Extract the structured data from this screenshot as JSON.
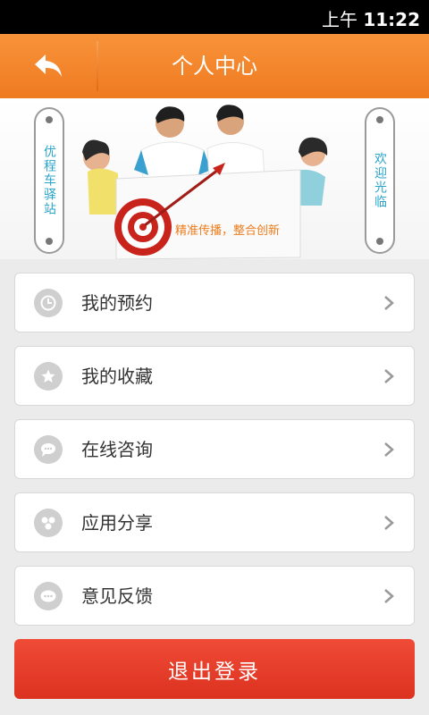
{
  "status_bar": {
    "ampm": "上午",
    "time": "11:22"
  },
  "header": {
    "title": "个人中心",
    "back_icon": "back-arrow-icon"
  },
  "banner": {
    "left_tag": "优程车驿站",
    "right_tag": "欢迎光临",
    "slogan": "精准传播，整合创新"
  },
  "menu": {
    "items": [
      {
        "label": "我的预约",
        "icon": "clock-icon"
      },
      {
        "label": "我的收藏",
        "icon": "star-icon"
      },
      {
        "label": "在线咨询",
        "icon": "chat-icon"
      },
      {
        "label": "应用分享",
        "icon": "share-icon"
      },
      {
        "label": "意见反馈",
        "icon": "feedback-icon"
      }
    ]
  },
  "logout": {
    "label": "退出登录"
  },
  "colors": {
    "header": "#f08424",
    "logout": "#e33c28",
    "tag_text": "#2aa4c9",
    "slogan": "#ee7c1c"
  }
}
